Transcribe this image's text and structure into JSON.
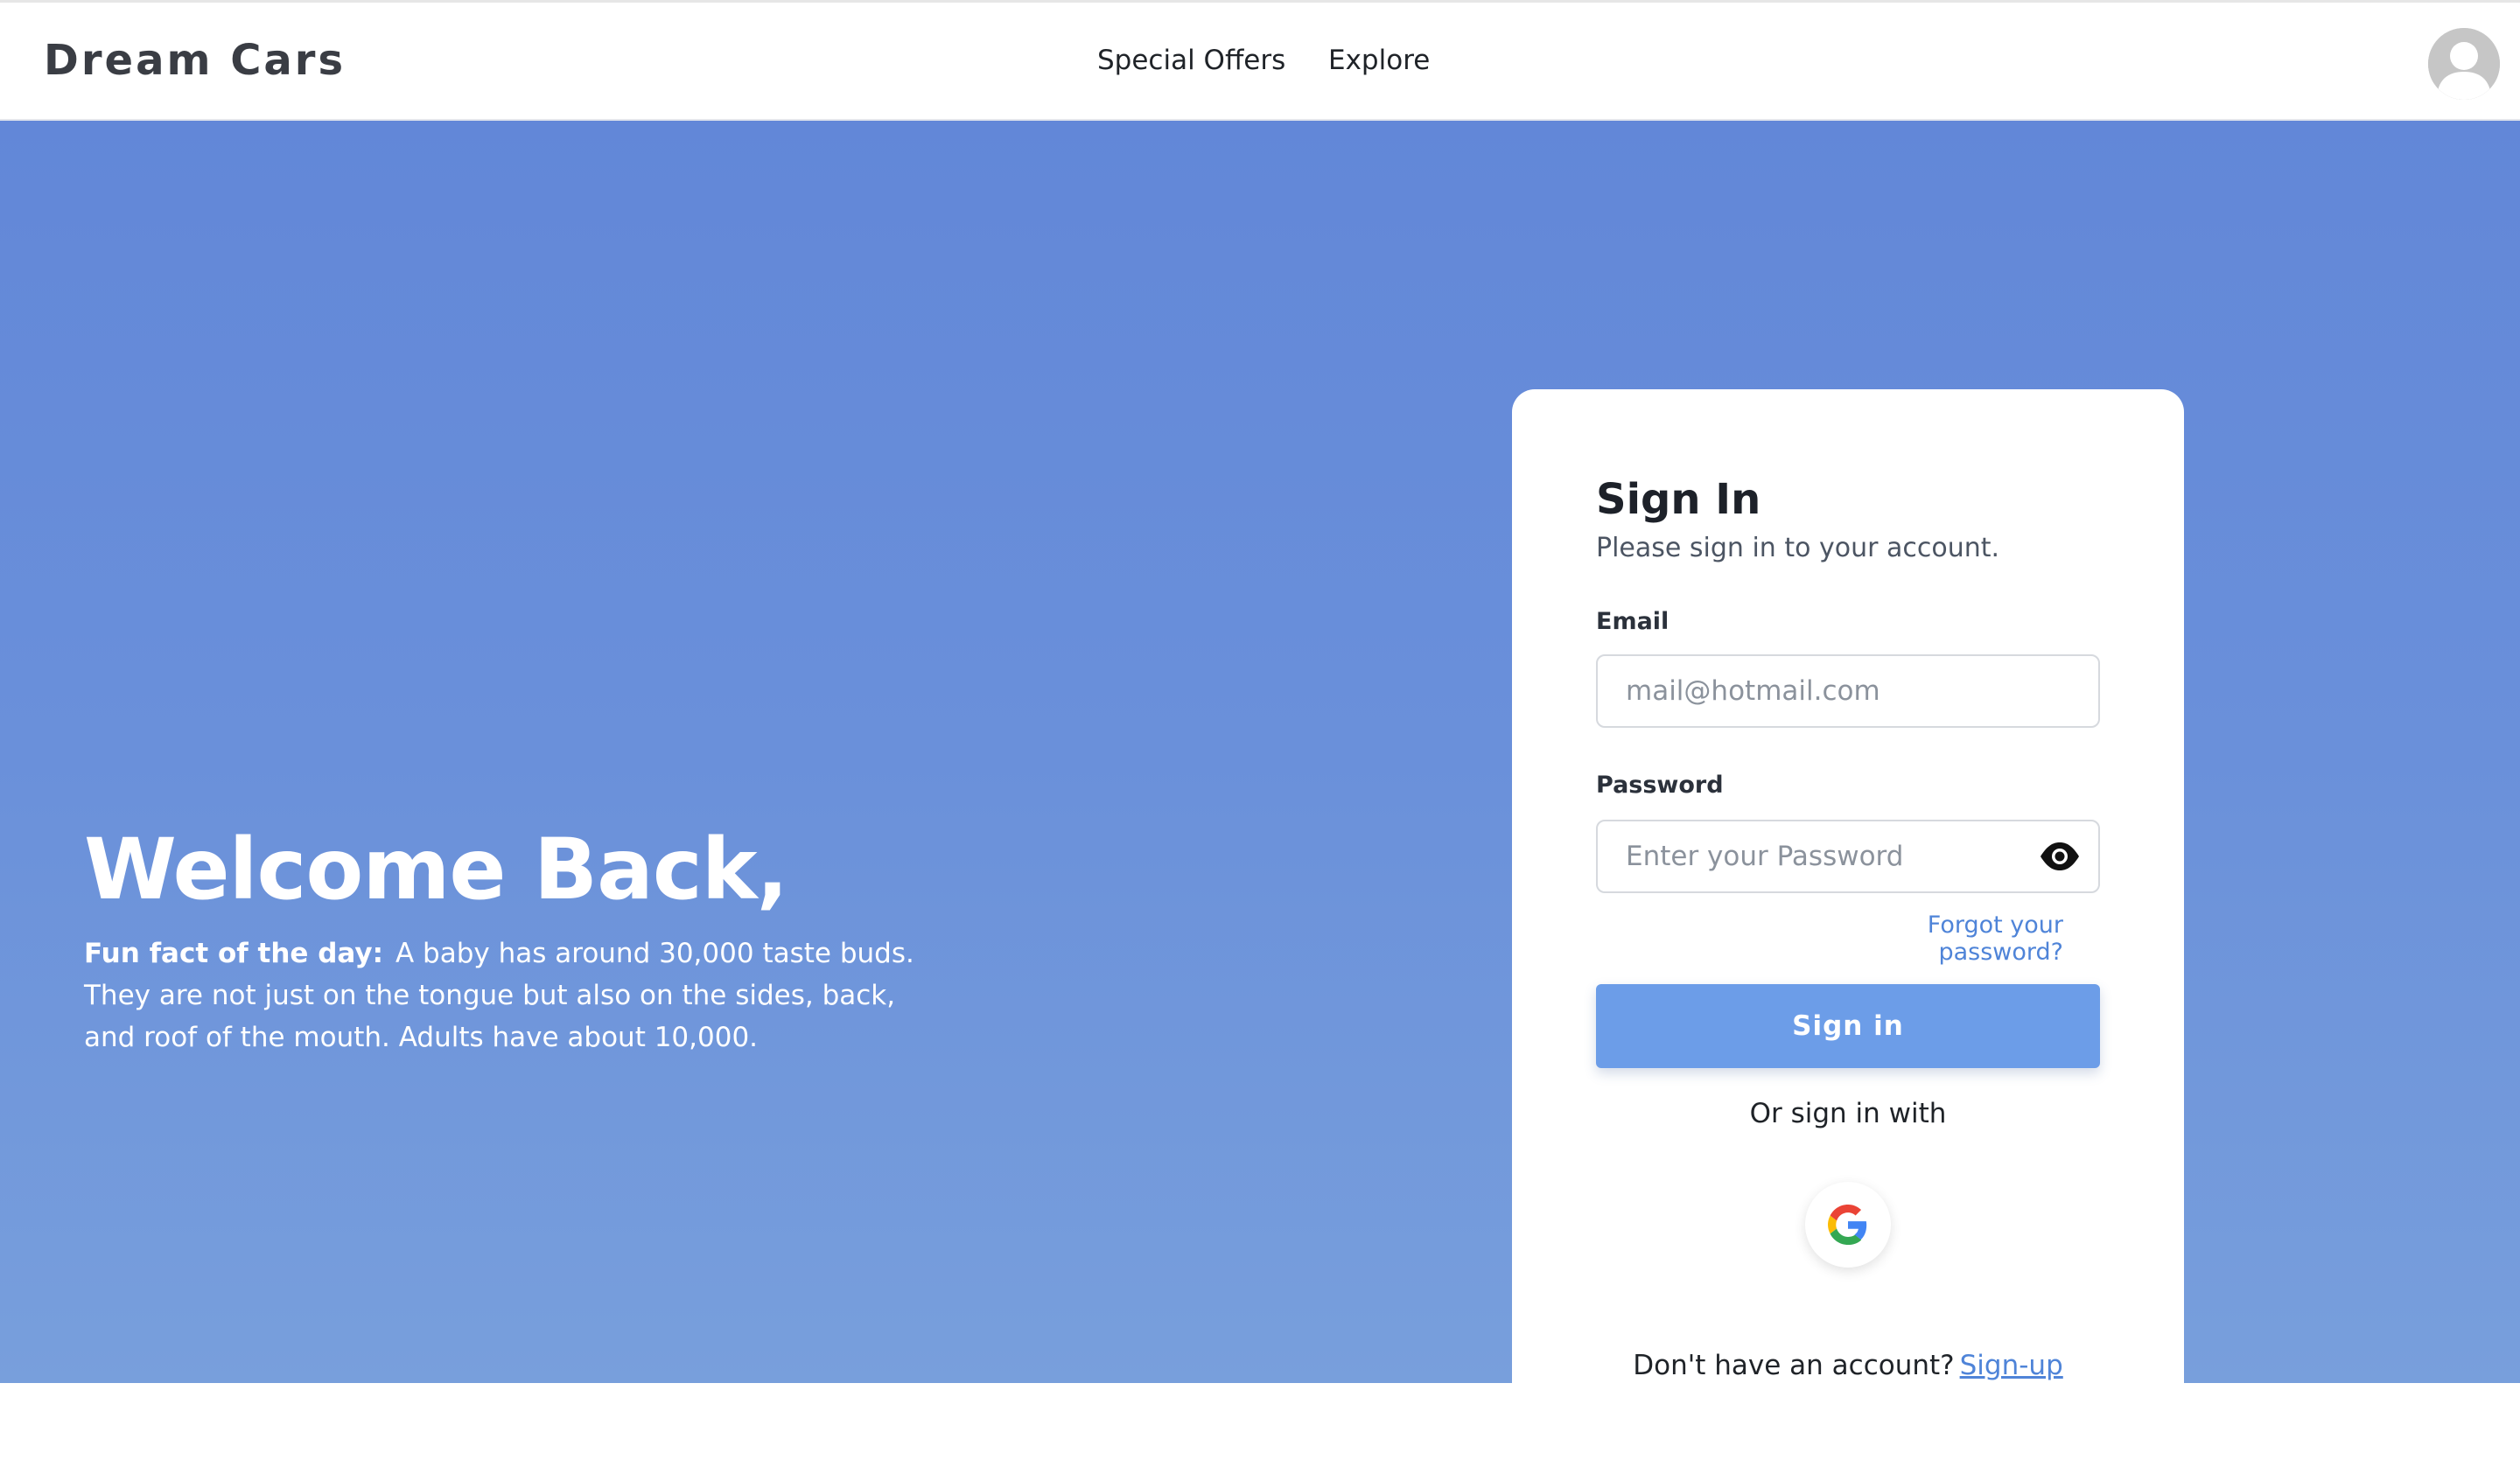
{
  "header": {
    "brand": "Dream Cars",
    "nav": [
      {
        "label": "Special Offers"
      },
      {
        "label": "Explore"
      }
    ],
    "avatar_icon": "user-avatar-icon"
  },
  "hero": {
    "welcome": "Welcome Back,",
    "fun_fact_label": "Fun fact of the day:",
    "fun_fact_text": "A baby has around 30,000 taste buds. They are not just on the tongue but also on the sides, back, and roof of the mouth. Adults have about 10,000."
  },
  "signin": {
    "title": "Sign In",
    "subtitle": "Please sign in to your account.",
    "email_label": "Email",
    "email_placeholder": "mail@hotmail.com",
    "email_value": "",
    "password_label": "Password",
    "password_placeholder": "Enter your Password",
    "password_value": "",
    "forgot_label": "Forgot your password?",
    "submit_label": "Sign in",
    "or_text": "Or sign in with",
    "social_icon": "google-icon",
    "no_account_text": "Don't have an account?",
    "signup_label": "Sign-up"
  },
  "colors": {
    "hero_top": "#6287d8",
    "hero_bottom": "#789fdc",
    "button": "#6c9de8",
    "link": "#4f84d8"
  }
}
